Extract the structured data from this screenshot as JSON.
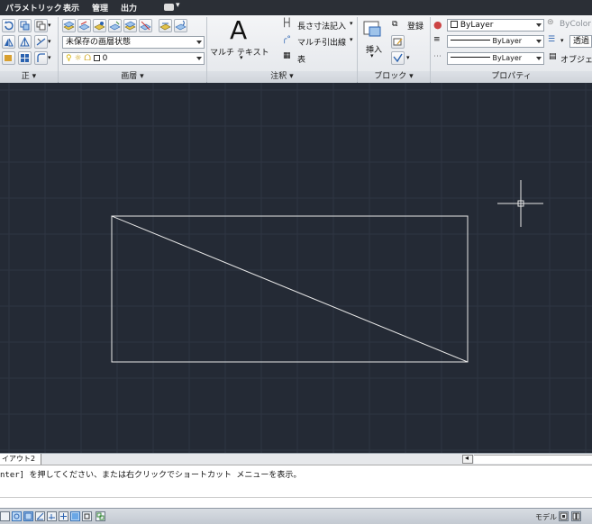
{
  "menubar": {
    "items": [
      "パラメトリック",
      "表示",
      "管理",
      "出力"
    ]
  },
  "ribbon": {
    "modify_panel": {
      "title": "正"
    },
    "layers_panel": {
      "title": "画層",
      "layer_state_value": "未保存の画層状態",
      "layer_value": "0"
    },
    "annotation_panel": {
      "title": "注釈",
      "mtext_label": "マルチ テキスト",
      "dimension_label": "長さ寸法記入",
      "multileader_label": "マルチ引出線",
      "table_label": "表"
    },
    "block_panel": {
      "title": "ブロック",
      "insert_label": "挿入",
      "register_label": "登録"
    },
    "properties_panel": {
      "title": "プロパティ",
      "color_value": "ByLayer",
      "linetype_value": "ByLayer",
      "lineweight_value": "ByLayer",
      "bycolor_label": "ByColor",
      "transparency_label": "透過",
      "object_label": "オブジェク"
    }
  },
  "tabs": {
    "layout_tab": "イアウト2"
  },
  "command": {
    "prompt": "nter] を押してください、または右クリックでショートカット メニューを表示。"
  },
  "status": {
    "model_label": "モデル"
  },
  "colors": {
    "canvas_bg": "#242a35",
    "grid_line": "#2e3542",
    "drawing_line": "#e8e8e8",
    "menubar_bg": "#2b2f36"
  }
}
